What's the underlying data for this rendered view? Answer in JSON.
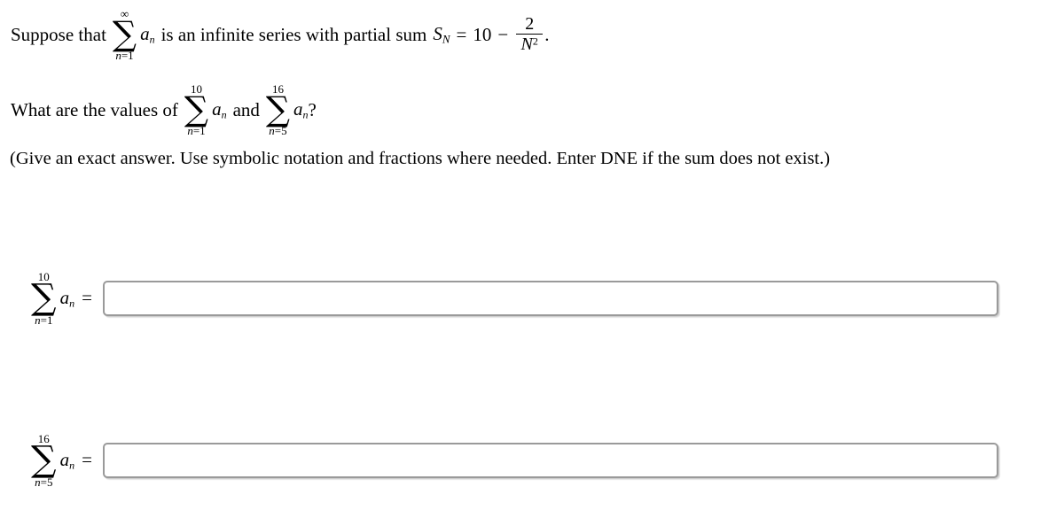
{
  "page": {
    "background_color": "#ffffff",
    "text_color": "#000000"
  },
  "problem": {
    "line1": {
      "lead_text": "Suppose that",
      "sum": {
        "upper_limit": "∞",
        "lower_limit_var": "n",
        "lower_limit_eq": "=",
        "lower_limit_val": "1",
        "summand_var": "a",
        "summand_sub": "n"
      },
      "mid_text": "is an infinite series with partial sum",
      "partial_sum_symbol": "S",
      "partial_sum_sub": "N",
      "equals": "=",
      "value_integer": "10",
      "minus": "−",
      "fraction_numerator": "2",
      "fraction_denominator_base": "N",
      "fraction_denominator_exp": "2",
      "period": "."
    },
    "line2": {
      "lead_text": "What are the values of",
      "sum_a": {
        "upper_limit": "10",
        "lower_limit_var": "n",
        "lower_limit_eq": "=",
        "lower_limit_val": "1",
        "summand_var": "a",
        "summand_sub": "n"
      },
      "conjunction": "and",
      "sum_b": {
        "upper_limit": "16",
        "lower_limit_var": "n",
        "lower_limit_eq": "=",
        "lower_limit_val": "5",
        "summand_var": "a",
        "summand_sub": "n"
      },
      "question_mark": "?"
    },
    "instructions": "(Give an exact answer. Use symbolic notation and fractions where needed. Enter DNE if the sum does not exist.)"
  },
  "answers": [
    {
      "label_sum": {
        "upper_limit": "10",
        "lower_limit_var": "n",
        "lower_limit_eq": "=",
        "lower_limit_val": "1",
        "summand_var": "a",
        "summand_sub": "n"
      },
      "equals": "=",
      "input_value": "",
      "input_placeholder": ""
    },
    {
      "label_sum": {
        "upper_limit": "16",
        "lower_limit_var": "n",
        "lower_limit_eq": "=",
        "lower_limit_val": "5",
        "summand_var": "a",
        "summand_sub": "n"
      },
      "equals": "=",
      "input_value": "",
      "input_placeholder": ""
    }
  ]
}
